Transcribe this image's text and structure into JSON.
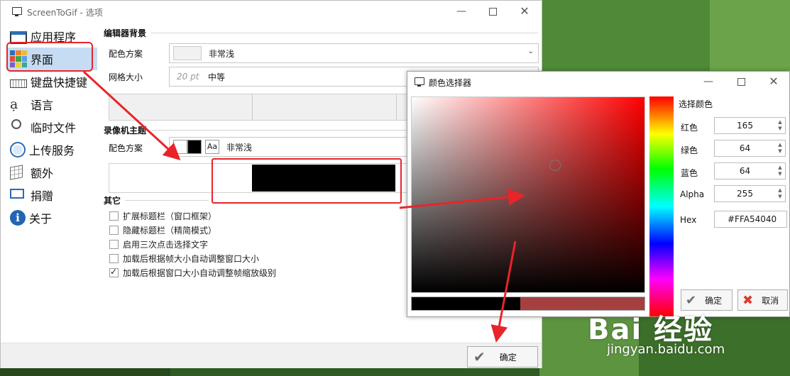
{
  "main_window": {
    "title": "ScreenToGif - 选项",
    "sidebar": [
      {
        "label": "应用程序",
        "icon": "window-icon"
      },
      {
        "label": "界面",
        "icon": "palette-grid-icon",
        "active": true
      },
      {
        "label": "键盘快捷键",
        "icon": "keyboard-icon"
      },
      {
        "label": "语言",
        "icon": "language-icon"
      },
      {
        "label": "临时文件",
        "icon": "clock-icon"
      },
      {
        "label": "上传服务",
        "icon": "globe-icon"
      },
      {
        "label": "额外",
        "icon": "cube-icon"
      },
      {
        "label": "捐赠",
        "icon": "donate-icon"
      },
      {
        "label": "关于",
        "icon": "info-icon"
      }
    ],
    "editor_bg": {
      "heading": "编辑器背景",
      "scheme_label": "配色方案",
      "scheme_value": "非常浅",
      "grid_label": "网格大小",
      "grid_pt": "20 pt",
      "grid_value": "中等"
    },
    "recorder_theme": {
      "heading": "录像机主题",
      "scheme_label": "配色方案",
      "aa": "Aa",
      "scheme_value": "非常浅"
    },
    "other": {
      "heading": "其它",
      "checks": [
        {
          "label": "扩展标题栏（窗口框架）",
          "checked": false
        },
        {
          "label": "隐藏标题栏（精简模式）",
          "checked": false
        },
        {
          "label": "启用三次点击选择文字",
          "checked": false
        },
        {
          "label": "加载后根据帧大小自动调整窗口大小",
          "checked": false
        },
        {
          "label": "加载后根据窗口大小自动调整帧缩放级别",
          "checked": true
        }
      ]
    },
    "ok_label": "确定"
  },
  "color_picker": {
    "title": "颜色选择器",
    "heading": "选择颜色",
    "red_label": "红色",
    "red": "165",
    "green_label": "绿色",
    "green": "64",
    "blue_label": "蓝色",
    "blue": "64",
    "alpha_label": "Alpha",
    "alpha": "255",
    "hex_label": "Hex",
    "hex": "#FFA54040",
    "ok_label": "确定",
    "cancel_label": "取消",
    "old_color": "#000000",
    "new_color": "#A54040"
  },
  "watermark": {
    "logo": "Bai 经验",
    "url": "jingyan.baidu.com"
  },
  "colors": {
    "accent_highlight": "#E8242A",
    "selection": "#C6DCF3"
  }
}
